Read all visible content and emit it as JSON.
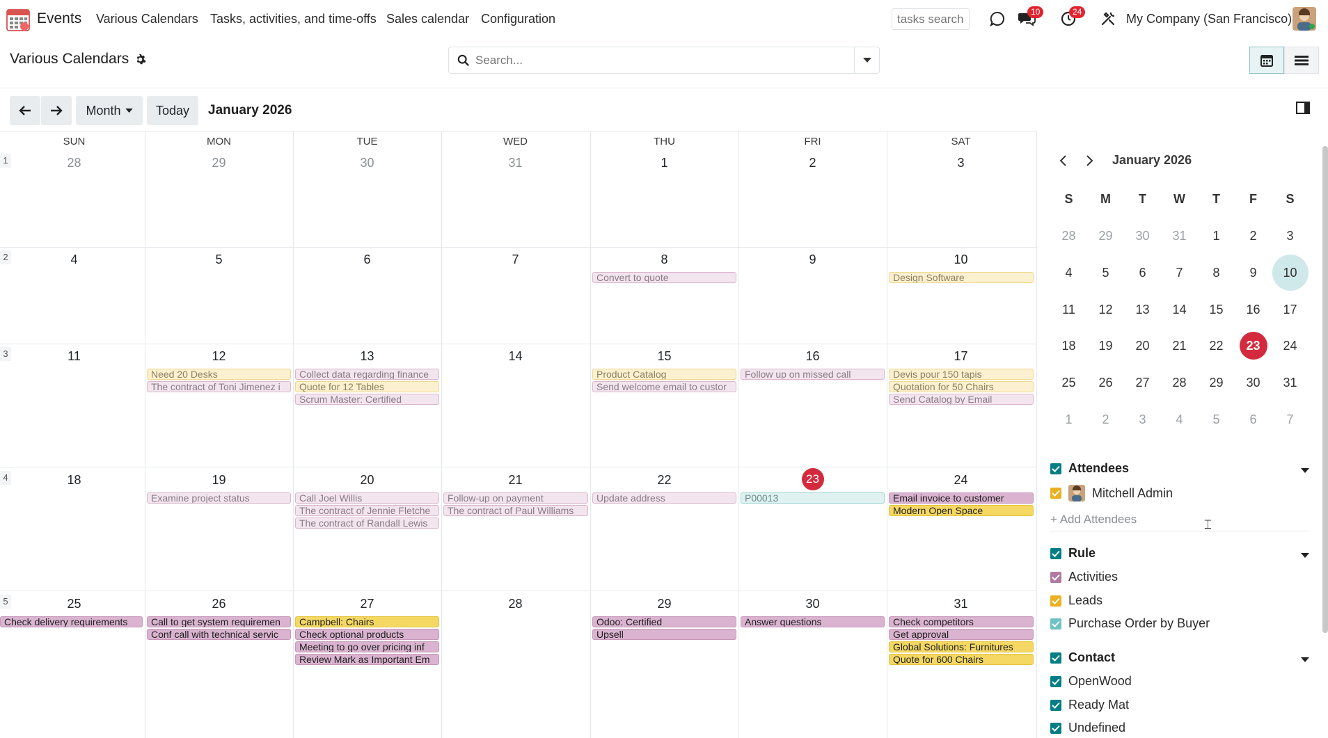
{
  "nav": {
    "app_name": "Events",
    "items": [
      "Various Calendars",
      "Tasks, activities, and time-offs",
      "Sales calendar",
      "Configuration"
    ],
    "tasks_search_placeholder": "tasks search",
    "messages_badge": "10",
    "activities_badge": "24",
    "company": "My Company (San Francisco)"
  },
  "control": {
    "title": "Various Calendars",
    "search_placeholder": "Search..."
  },
  "toolbar": {
    "scale": "Month",
    "today": "Today",
    "range": "January 2026"
  },
  "calendar": {
    "dow": [
      "SUN",
      "MON",
      "TUE",
      "WED",
      "THU",
      "FRI",
      "SAT"
    ],
    "weeks": [
      {
        "no": "1",
        "days": [
          "28",
          "29",
          "30",
          "31",
          "1",
          "2",
          "3"
        ]
      },
      {
        "no": "2",
        "days": [
          "4",
          "5",
          "6",
          "7",
          "8",
          "9",
          "10"
        ]
      },
      {
        "no": "3",
        "days": [
          "11",
          "12",
          "13",
          "14",
          "15",
          "16",
          "17"
        ]
      },
      {
        "no": "4",
        "days": [
          "18",
          "19",
          "20",
          "21",
          "22",
          "23",
          "24"
        ]
      },
      {
        "no": "5",
        "days": [
          "25",
          "26",
          "27",
          "28",
          "29",
          "30",
          "31"
        ]
      }
    ],
    "events": {
      "w2": {
        "thu": [
          "Convert to quote"
        ],
        "sat": [
          "Design Software"
        ]
      },
      "w3": {
        "mon": [
          "Need 20 Desks",
          "The contract of Toni Jimenez i"
        ],
        "tue": [
          "Collect data regarding finance",
          "Quote for 12 Tables",
          "Scrum Master: Certified"
        ],
        "thu": [
          "Product Catalog",
          "Send welcome email to custor"
        ],
        "fri": [
          "Follow up on missed call"
        ],
        "sat": [
          "Devis pour 150 tapis",
          "Quotation for 50 Chairs",
          "Send Catalog by Email"
        ]
      },
      "w4": {
        "mon": [
          "Examine project status"
        ],
        "tue": [
          "Call Joel Willis",
          "The contract of Jennie Fletche",
          "The contract of Randall Lewis"
        ],
        "wed": [
          "Follow-up on payment",
          "The contract of Paul Williams"
        ],
        "thu": [
          "Update address"
        ],
        "fri": [
          "P00013"
        ],
        "sat": [
          "Email invoice to customer",
          "Modern Open Space"
        ]
      },
      "w5": {
        "sun": [
          "Check delivery requirements"
        ],
        "mon": [
          "Call to get system requiremen",
          "Conf call with technical servic"
        ],
        "tue": [
          "Campbell: Chairs",
          "Check optional products",
          "Meeting to go over pricing inf",
          "Review Mark as Important Em"
        ],
        "thu": [
          "Odoo: Certified",
          "Upsell"
        ],
        "fri": [
          "Answer questions"
        ],
        "sat": [
          "Check competitors",
          "Get approval",
          "Global Solutions: Furnitures",
          "Quote for 600 Chairs"
        ]
      }
    }
  },
  "mini": {
    "title": "January 2026",
    "dow": [
      "S",
      "M",
      "T",
      "W",
      "T",
      "F",
      "S"
    ],
    "rows": [
      [
        "28",
        "29",
        "30",
        "31",
        "1",
        "2",
        "3"
      ],
      [
        "4",
        "5",
        "6",
        "7",
        "8",
        "9",
        "10"
      ],
      [
        "11",
        "12",
        "13",
        "14",
        "15",
        "16",
        "17"
      ],
      [
        "18",
        "19",
        "20",
        "21",
        "22",
        "23",
        "24"
      ],
      [
        "25",
        "26",
        "27",
        "28",
        "29",
        "30",
        "31"
      ],
      [
        "1",
        "2",
        "3",
        "4",
        "5",
        "6",
        "7"
      ]
    ]
  },
  "filters": {
    "attendees": {
      "title": "Attendees",
      "items": [
        "Mitchell Admin"
      ],
      "add": "+ Add Attendees"
    },
    "rule": {
      "title": "Rule",
      "items": [
        "Activities",
        "Leads",
        "Purchase Order by Buyer"
      ]
    },
    "contact": {
      "title": "Contact",
      "items": [
        "OpenWood",
        "Ready Mat",
        "Undefined"
      ]
    }
  },
  "colors": {
    "accent": "#017e84",
    "today": "#d42a3d",
    "checkbox": "#017e84",
    "rule_activities": "#b07aa1",
    "rule_leads": "#eab020",
    "rule_po": "#6fc2c4"
  }
}
